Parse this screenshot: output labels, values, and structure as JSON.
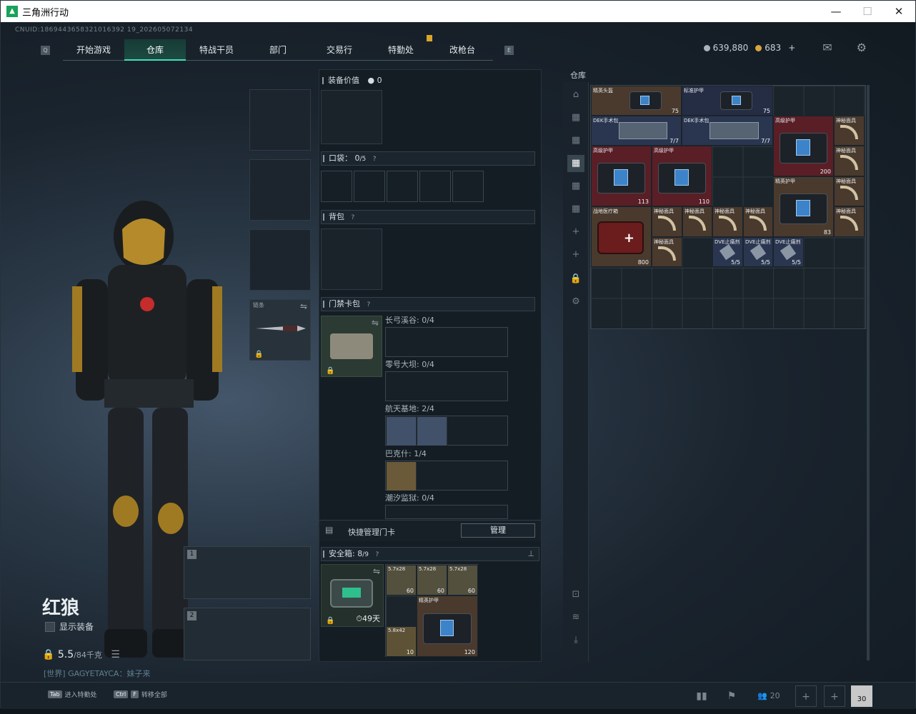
{
  "window": {
    "title": "三角洲行动",
    "min": "—",
    "max": "☐",
    "close": "✕"
  },
  "uid": "CNUID:1869443658321016392 19_202605072134",
  "nav": {
    "left_icon": "Q",
    "tabs": [
      {
        "label": "开始游戏",
        "active": false
      },
      {
        "label": "仓库",
        "active": true
      },
      {
        "label": "特战干员",
        "active": false
      },
      {
        "label": "部门",
        "active": false
      },
      {
        "label": "交易行",
        "active": false
      },
      {
        "label": "特勤处",
        "active": false
      },
      {
        "label": "改枪台",
        "active": false
      }
    ],
    "right_icon": "E"
  },
  "currency": {
    "silver": "639,880",
    "gold": "683",
    "plus": "+"
  },
  "icons": {
    "mail": "mail-icon",
    "settings": "gear-icon"
  },
  "character": {
    "name": "红狼",
    "show_equip": "显示装备",
    "weight_value": "5.5",
    "weight_max": "/84千克",
    "chat": "[世界] GAGYETAYCA：妹子来"
  },
  "equipment": {
    "melee_label": "链条",
    "weapon1_num": "1",
    "weapon2_num": "2"
  },
  "middle": {
    "equip_value_label": "装备价值",
    "equip_value": "0",
    "pocket_label": "口袋：",
    "pocket_count": "0",
    "pocket_max": "/5",
    "backpack_label": "背包",
    "keycard_label": "门禁卡包",
    "keycards": [
      {
        "map": "长弓溪谷:",
        "count": "0/4"
      },
      {
        "map": "零号大坝:",
        "count": "0/4"
      },
      {
        "map": "航天基地:",
        "count": "2/4"
      },
      {
        "map": "巴克什:",
        "count": "1/4"
      },
      {
        "map": "潮汐监狱:",
        "count": "0/4"
      }
    ],
    "quick_manage_label": "快捷管理门卡",
    "manage_button": "管理",
    "safe_label": "安全箱:",
    "safe_count": "8",
    "safe_max": "/9",
    "safe_days": "49天",
    "safe_items": [
      {
        "name": "5.7x28",
        "count": "60"
      },
      {
        "name": "5.7x28",
        "count": "60"
      },
      {
        "name": "5.7x28",
        "count": "60"
      },
      {
        "name": "精英护甲",
        "count": "120"
      },
      {
        "name": "5.8x42",
        "count": "10"
      }
    ]
  },
  "stash": {
    "title": "仓库",
    "items": [
      {
        "name": "精英头盔",
        "count": "75",
        "kind": "armor"
      },
      {
        "name": "标准护甲",
        "count": "75",
        "kind": "armor"
      },
      {
        "name": "DEK手术包",
        "count": "7/7",
        "kind": "kit"
      },
      {
        "name": "DEK手术包",
        "count": "7/7",
        "kind": "kit"
      },
      {
        "name": "高级护甲",
        "count": "200",
        "kind": "armor"
      },
      {
        "name": "高级护甲",
        "count": "113",
        "kind": "armor"
      },
      {
        "name": "高级护甲",
        "count": "110",
        "kind": "armor"
      },
      {
        "name": "精英护甲",
        "count": "83",
        "kind": "armor"
      },
      {
        "name": "战地医疗箱",
        "count": "800",
        "kind": "med"
      },
      {
        "name": "神秘面具",
        "count": "",
        "kind": "mask"
      },
      {
        "name": "DVE止痛剂",
        "count": "5/5",
        "kind": "syringe"
      },
      {
        "name": "DVE止痛剂",
        "count": "5/5",
        "kind": "syringe"
      },
      {
        "name": "DVE止痛剂",
        "count": "5/5",
        "kind": "syringe"
      }
    ]
  },
  "bottom": {
    "hint1_key": "Tab",
    "hint1": "进入特勤处",
    "hint2_key": "Ctrl",
    "hint2_key2": "F",
    "hint2": "转移全部",
    "friends": "20",
    "card_count": "30"
  },
  "colors": {
    "accent": "#3fe0b3",
    "gold": "#d7a72a"
  }
}
